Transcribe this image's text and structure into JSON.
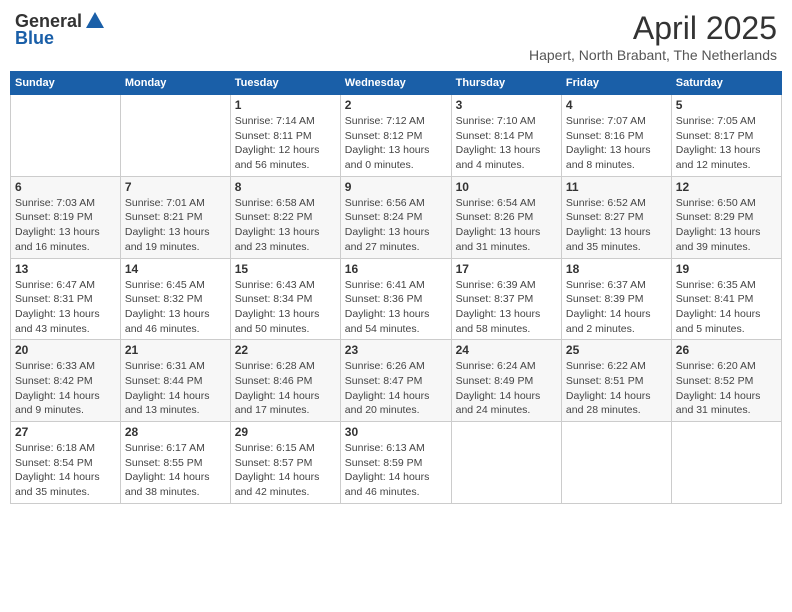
{
  "header": {
    "logo_general": "General",
    "logo_blue": "Blue",
    "month": "April 2025",
    "location": "Hapert, North Brabant, The Netherlands"
  },
  "days_of_week": [
    "Sunday",
    "Monday",
    "Tuesday",
    "Wednesday",
    "Thursday",
    "Friday",
    "Saturday"
  ],
  "weeks": [
    [
      {
        "day": "",
        "info": ""
      },
      {
        "day": "",
        "info": ""
      },
      {
        "day": "1",
        "info": "Sunrise: 7:14 AM\nSunset: 8:11 PM\nDaylight: 12 hours and 56 minutes."
      },
      {
        "day": "2",
        "info": "Sunrise: 7:12 AM\nSunset: 8:12 PM\nDaylight: 13 hours and 0 minutes."
      },
      {
        "day": "3",
        "info": "Sunrise: 7:10 AM\nSunset: 8:14 PM\nDaylight: 13 hours and 4 minutes."
      },
      {
        "day": "4",
        "info": "Sunrise: 7:07 AM\nSunset: 8:16 PM\nDaylight: 13 hours and 8 minutes."
      },
      {
        "day": "5",
        "info": "Sunrise: 7:05 AM\nSunset: 8:17 PM\nDaylight: 13 hours and 12 minutes."
      }
    ],
    [
      {
        "day": "6",
        "info": "Sunrise: 7:03 AM\nSunset: 8:19 PM\nDaylight: 13 hours and 16 minutes."
      },
      {
        "day": "7",
        "info": "Sunrise: 7:01 AM\nSunset: 8:21 PM\nDaylight: 13 hours and 19 minutes."
      },
      {
        "day": "8",
        "info": "Sunrise: 6:58 AM\nSunset: 8:22 PM\nDaylight: 13 hours and 23 minutes."
      },
      {
        "day": "9",
        "info": "Sunrise: 6:56 AM\nSunset: 8:24 PM\nDaylight: 13 hours and 27 minutes."
      },
      {
        "day": "10",
        "info": "Sunrise: 6:54 AM\nSunset: 8:26 PM\nDaylight: 13 hours and 31 minutes."
      },
      {
        "day": "11",
        "info": "Sunrise: 6:52 AM\nSunset: 8:27 PM\nDaylight: 13 hours and 35 minutes."
      },
      {
        "day": "12",
        "info": "Sunrise: 6:50 AM\nSunset: 8:29 PM\nDaylight: 13 hours and 39 minutes."
      }
    ],
    [
      {
        "day": "13",
        "info": "Sunrise: 6:47 AM\nSunset: 8:31 PM\nDaylight: 13 hours and 43 minutes."
      },
      {
        "day": "14",
        "info": "Sunrise: 6:45 AM\nSunset: 8:32 PM\nDaylight: 13 hours and 46 minutes."
      },
      {
        "day": "15",
        "info": "Sunrise: 6:43 AM\nSunset: 8:34 PM\nDaylight: 13 hours and 50 minutes."
      },
      {
        "day": "16",
        "info": "Sunrise: 6:41 AM\nSunset: 8:36 PM\nDaylight: 13 hours and 54 minutes."
      },
      {
        "day": "17",
        "info": "Sunrise: 6:39 AM\nSunset: 8:37 PM\nDaylight: 13 hours and 58 minutes."
      },
      {
        "day": "18",
        "info": "Sunrise: 6:37 AM\nSunset: 8:39 PM\nDaylight: 14 hours and 2 minutes."
      },
      {
        "day": "19",
        "info": "Sunrise: 6:35 AM\nSunset: 8:41 PM\nDaylight: 14 hours and 5 minutes."
      }
    ],
    [
      {
        "day": "20",
        "info": "Sunrise: 6:33 AM\nSunset: 8:42 PM\nDaylight: 14 hours and 9 minutes."
      },
      {
        "day": "21",
        "info": "Sunrise: 6:31 AM\nSunset: 8:44 PM\nDaylight: 14 hours and 13 minutes."
      },
      {
        "day": "22",
        "info": "Sunrise: 6:28 AM\nSunset: 8:46 PM\nDaylight: 14 hours and 17 minutes."
      },
      {
        "day": "23",
        "info": "Sunrise: 6:26 AM\nSunset: 8:47 PM\nDaylight: 14 hours and 20 minutes."
      },
      {
        "day": "24",
        "info": "Sunrise: 6:24 AM\nSunset: 8:49 PM\nDaylight: 14 hours and 24 minutes."
      },
      {
        "day": "25",
        "info": "Sunrise: 6:22 AM\nSunset: 8:51 PM\nDaylight: 14 hours and 28 minutes."
      },
      {
        "day": "26",
        "info": "Sunrise: 6:20 AM\nSunset: 8:52 PM\nDaylight: 14 hours and 31 minutes."
      }
    ],
    [
      {
        "day": "27",
        "info": "Sunrise: 6:18 AM\nSunset: 8:54 PM\nDaylight: 14 hours and 35 minutes."
      },
      {
        "day": "28",
        "info": "Sunrise: 6:17 AM\nSunset: 8:55 PM\nDaylight: 14 hours and 38 minutes."
      },
      {
        "day": "29",
        "info": "Sunrise: 6:15 AM\nSunset: 8:57 PM\nDaylight: 14 hours and 42 minutes."
      },
      {
        "day": "30",
        "info": "Sunrise: 6:13 AM\nSunset: 8:59 PM\nDaylight: 14 hours and 46 minutes."
      },
      {
        "day": "",
        "info": ""
      },
      {
        "day": "",
        "info": ""
      },
      {
        "day": "",
        "info": ""
      }
    ]
  ]
}
